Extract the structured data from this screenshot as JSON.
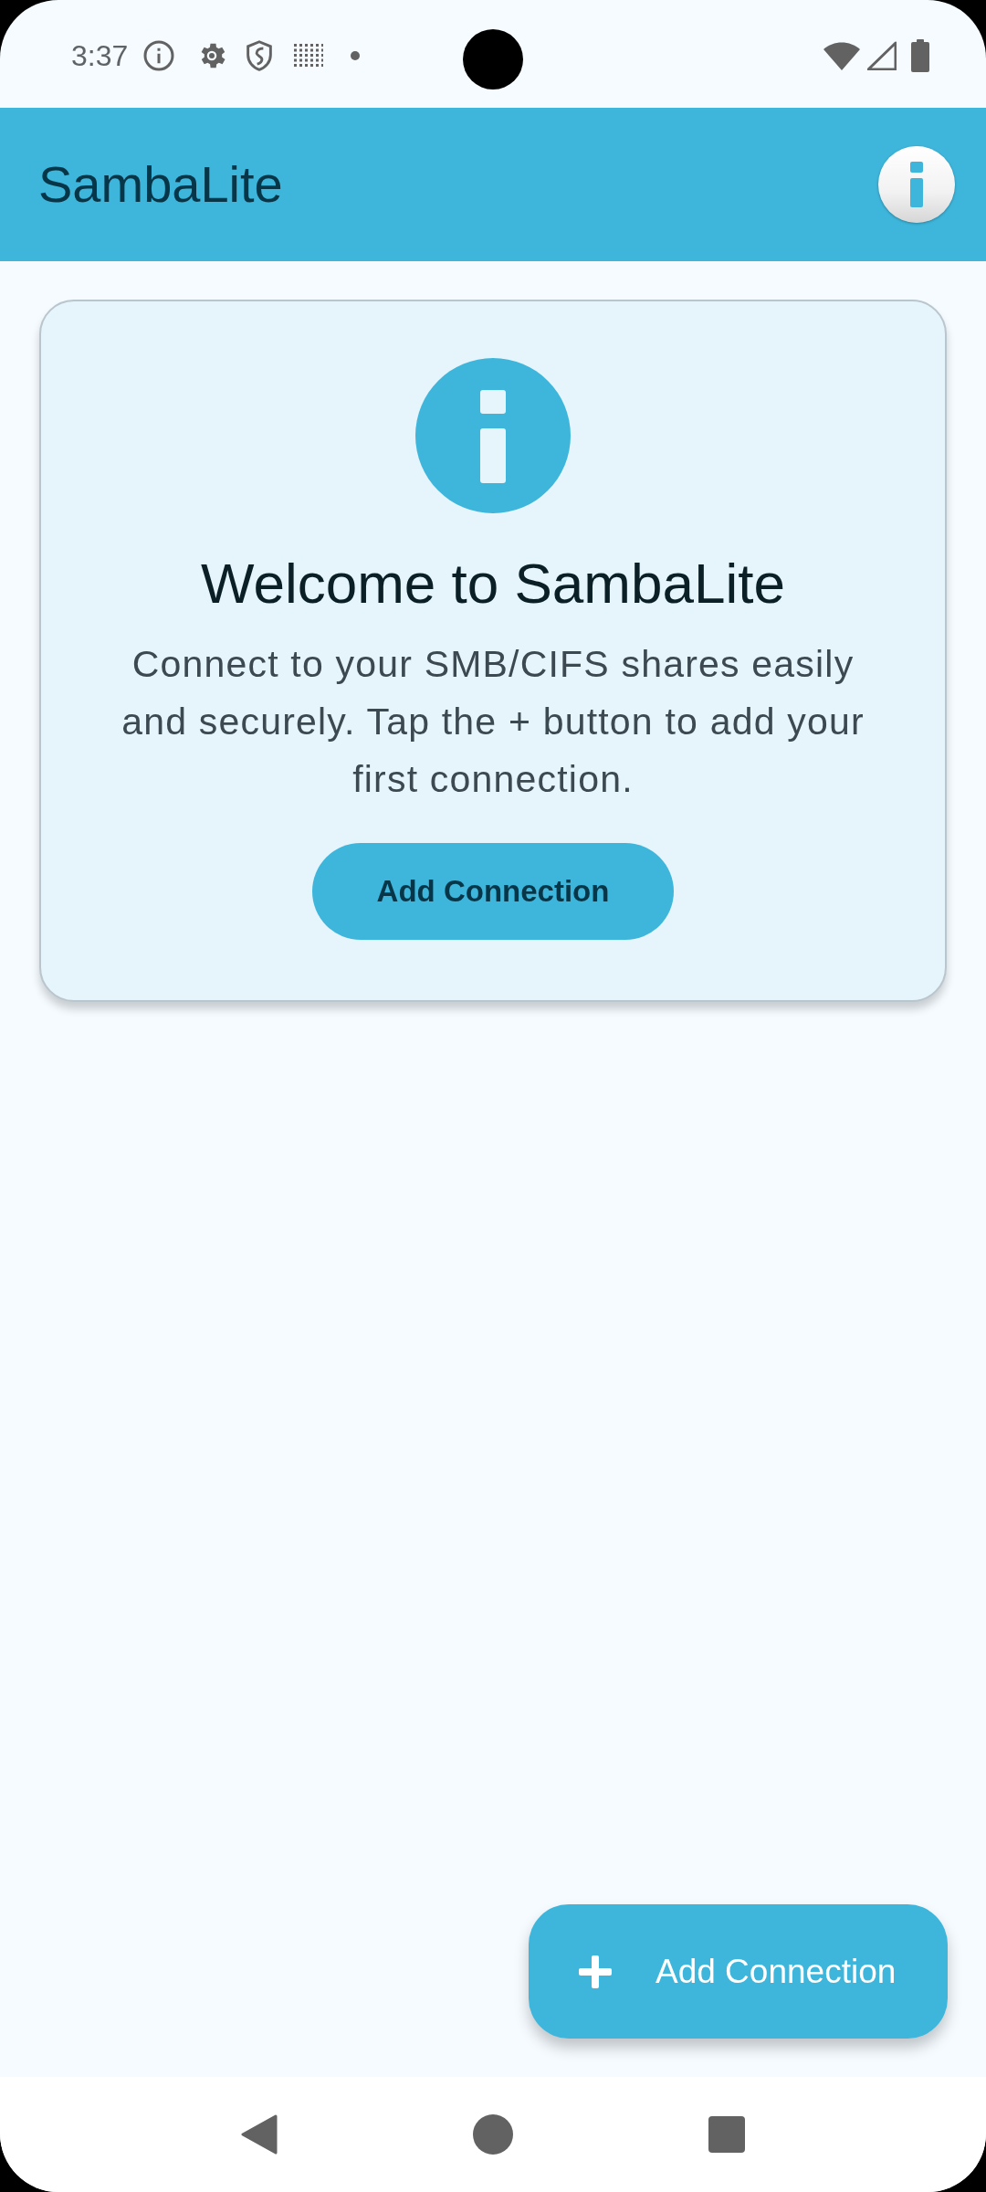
{
  "status_bar": {
    "time": "3:37"
  },
  "app_bar": {
    "title": "SambaLite"
  },
  "welcome_card": {
    "title": "Welcome to SambaLite",
    "description": "Connect to your SMB/CIFS shares easily and securely. Tap the + button to add your first connection.",
    "button": "Add Connection"
  },
  "fab": {
    "label": "Add Connection"
  }
}
